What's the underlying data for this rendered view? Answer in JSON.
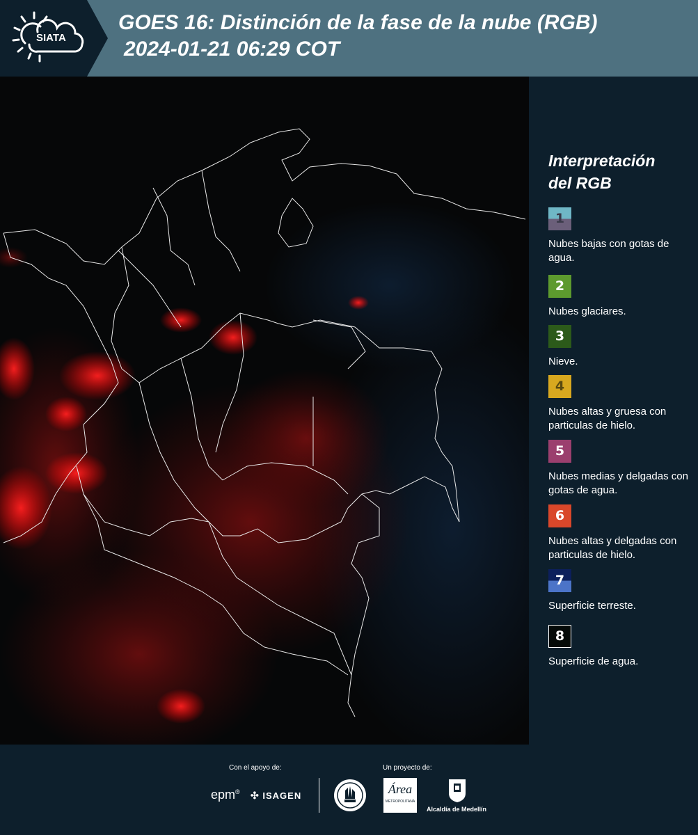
{
  "header": {
    "logo_text": "SIATA",
    "title_line1": "GOES 16: Distinción de la fase de la nube (RGB)",
    "title_line2": "2024-01-21 06:29 COT"
  },
  "legend": {
    "title_line1": "Interpretación",
    "title_line2": "del RGB",
    "items": [
      {
        "number": "1",
        "label": "Nubes bajas con gotas de agua.",
        "color_top": "#6fb7c6",
        "color_bottom": "#6b5f7a"
      },
      {
        "number": "2",
        "label": "Nubes glaciares.",
        "color_top": "#5d9a2e",
        "color_bottom": "#5d9a2e"
      },
      {
        "number": "3",
        "label": "Nieve.",
        "color_top": "#2c5a1a",
        "color_bottom": "#2c5a1a"
      },
      {
        "number": "4",
        "label": "Nubes altas y gruesa con particulas de hielo.",
        "color_top": "#d8a81f",
        "color_bottom": "#d8a81f"
      },
      {
        "number": "5",
        "label": "Nubes medias y delgadas con gotas de agua.",
        "color_top": "#9b3f6e",
        "color_bottom": "#9b3f6e"
      },
      {
        "number": "6",
        "label": "Nubes altas y delgadas con particulas de hielo.",
        "color_top": "#d9472a",
        "color_bottom": "#d9472a"
      },
      {
        "number": "7",
        "label": "Superficie terreste.",
        "color_top": "#0c1f5c",
        "color_bottom": "#4c74c8"
      },
      {
        "number": "8",
        "label": "Superficie de agua.",
        "color_top": "#050a08",
        "color_bottom": "#050a08"
      }
    ]
  },
  "footer": {
    "support_label": "Con el apoyo de:",
    "project_label": "Un proyecto de:",
    "sponsor_epm": "epm",
    "sponsor_isagen": "ISAGEN",
    "area_text": "Área",
    "area_sub": "METROPOLITANA",
    "alcaldia": "Alcaldía de Medellín"
  },
  "colors": {
    "header_bg": "#4e7180",
    "panel_bg": "#0d1f2c",
    "cloud_red": "#ff1a1a"
  }
}
